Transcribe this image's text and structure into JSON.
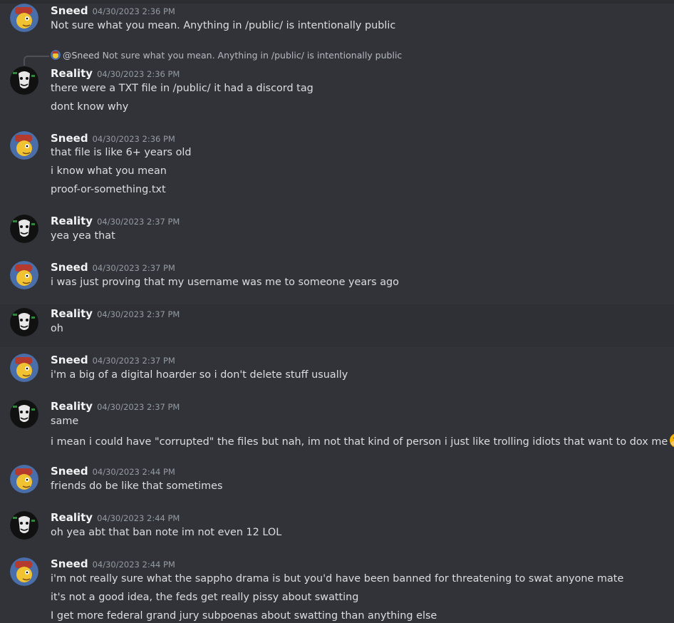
{
  "messages": [
    {
      "author": "Sneed",
      "timestamp": "04/30/2023 2:36 PM",
      "lines": [
        "Not sure what you mean. Anything in /public/ is intentionally public"
      ]
    },
    {
      "author": "Reality",
      "timestamp": "04/30/2023 2:36 PM",
      "reply": {
        "mention": "@Sneed",
        "text": "Not sure what you mean. Anything in /public/ is intentionally public"
      },
      "lines": [
        "there were a TXT file in /public/ it had a discord tag",
        "dont know why"
      ]
    },
    {
      "author": "Sneed",
      "timestamp": "04/30/2023 2:36 PM",
      "lines": [
        "that file is like 6+ years old",
        "i know what you mean",
        "proof-or-something.txt"
      ]
    },
    {
      "author": "Reality",
      "timestamp": "04/30/2023 2:37 PM",
      "lines": [
        "yea yea that"
      ]
    },
    {
      "author": "Sneed",
      "timestamp": "04/30/2023 2:37 PM",
      "lines": [
        "i was just proving that my username was me to someone years ago"
      ]
    },
    {
      "author": "Reality",
      "timestamp": "04/30/2023 2:37 PM",
      "lines": [
        "oh"
      ]
    },
    {
      "author": "Sneed",
      "timestamp": "04/30/2023 2:37 PM",
      "lines": [
        "i'm a big of a digital hoarder so i don't delete stuff usually"
      ]
    },
    {
      "author": "Reality",
      "timestamp": "04/30/2023 2:37 PM",
      "lines": [
        "same",
        "i mean i could have \"corrupted\" the files but nah, im not that kind of person i just like trolling idiots that want to dox me"
      ],
      "emoji": "yawning-face-icon"
    },
    {
      "author": "Sneed",
      "timestamp": "04/30/2023 2:44 PM",
      "lines": [
        "friends do be like that sometimes"
      ]
    },
    {
      "author": "Reality",
      "timestamp": "04/30/2023 2:44 PM",
      "lines": [
        "oh yea abt that ban note im not even 12 LOL"
      ]
    },
    {
      "author": "Sneed",
      "timestamp": "04/30/2023 2:44 PM",
      "lines": [
        "i'm not really sure what the sappho drama is but you'd have been banned for threatening to swat anyone mate",
        "it's not a good idea, the feds get really pissy about swatting",
        "I get more federal grand jury subpoenas about swatting than anything else"
      ]
    }
  ],
  "colors": {
    "background": "#313338",
    "hover": "#2e3035",
    "name": "#f2f3f5",
    "timestamp": "#949ba4",
    "text": "#dbdee1"
  }
}
